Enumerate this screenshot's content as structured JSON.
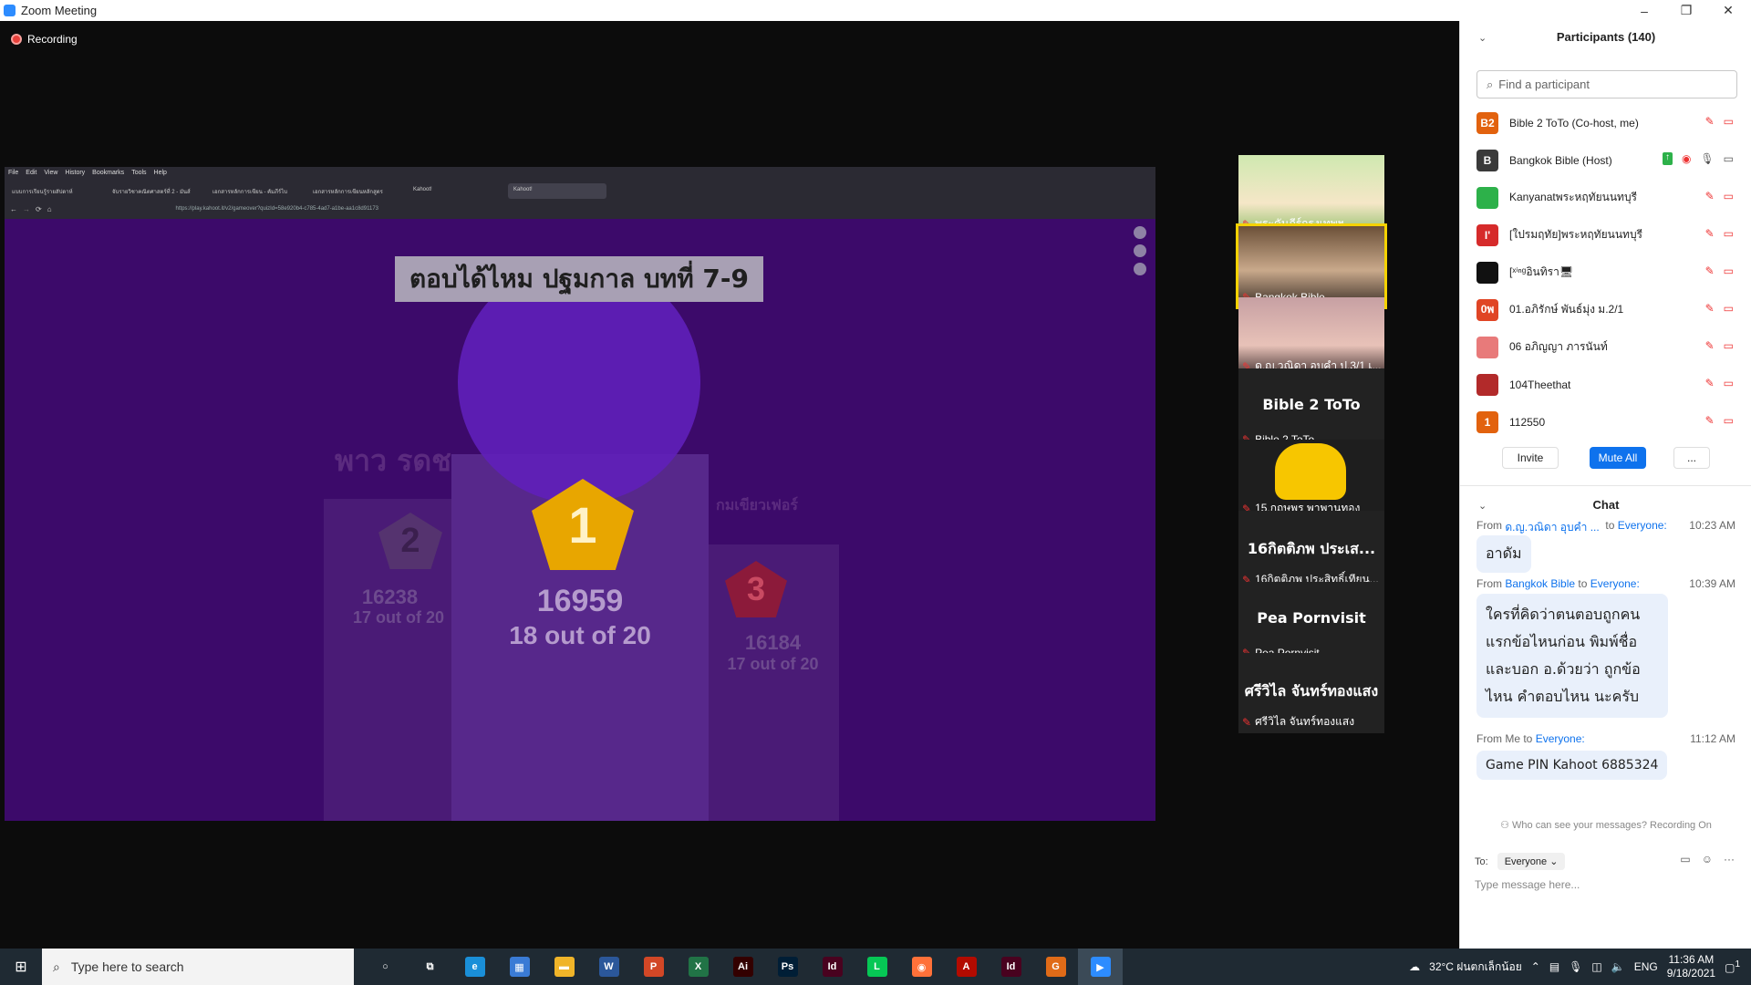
{
  "window": {
    "title": "Zoom Meeting",
    "minimize": "–",
    "restore": "❐",
    "close": "✕"
  },
  "recording_label": "Recording",
  "browser": {
    "menu": [
      "File",
      "Edit",
      "View",
      "History",
      "Bookmarks",
      "Tools",
      "Help"
    ],
    "tabs": [
      "แบบการเรียนรู้รายสัปดาห์",
      "จับรายวิชาคณิตศาสตร์ที่ 2 - มันส์",
      "เอกสารหลักการเขียน - คัมภีร์ไบ",
      "เอกสารหลักการเขียนหลักสูตร",
      "Kahoot!",
      "Kahoot!"
    ],
    "url": "https://play.kahoot.it/v2/gameover?quizId=58e920b4-c785-4ad7-a1be-aa1c8d91173"
  },
  "kahoot": {
    "question_title": "ตอบได้ไหม ปฐมกาล บทที่ 7-9",
    "nickname_2": "พาว รดช",
    "nickname_3": "กมเขียวเฟอร์",
    "place_1": {
      "rank": "1",
      "score": "16959",
      "correct": "18 out of 20"
    },
    "place_2": {
      "rank": "2",
      "score": "16238",
      "correct": "17 out of 20"
    },
    "place_3": {
      "rank": "3",
      "score": "16184",
      "correct": "17 out of 20"
    }
  },
  "gallery": [
    {
      "name": "พระคัมภีร์กรุงเทพฯ",
      "type": "poster"
    },
    {
      "name": "Bangkok Bible",
      "type": "video",
      "active": true
    },
    {
      "name": "ด.ญ.วณิดา อุบคำ ป.3/1 เ...",
      "type": "video"
    },
    {
      "name": "Bible 2 ToTo",
      "big": "Bible 2 ToTo",
      "type": "name"
    },
    {
      "name": "15.กฤษพร พาพานทอง",
      "type": "duck"
    },
    {
      "name": "16กิตติภพ ประสิทธิ์เทียน...",
      "big": "16กิตติภพ ประเส...",
      "type": "name"
    },
    {
      "name": "Pea Pornvisit",
      "big": "Pea Pornvisit",
      "type": "name"
    },
    {
      "name": "ศรีวิไล จันทร์ทองแสง",
      "big": "ศรีวิไล จันทร์ทองแสง",
      "type": "name"
    }
  ],
  "participants": {
    "header": "Participants (140)",
    "search_placeholder": "Find a participant",
    "list": [
      {
        "initials": "B2",
        "color": "#e2620e",
        "name": "Bible 2 ToTo (Co-host, me)"
      },
      {
        "initials": "B",
        "color": "#3a3a3a",
        "name": "Bangkok Bible (Host)"
      },
      {
        "initials": "",
        "color": "#2db14a",
        "name": "Kanyanatพระหฤทัยนนทบุรี"
      },
      {
        "initials": "I'",
        "color": "#d62b2b",
        "name": "[ใปรมฤทัย]พระหฤทัยนนทบุรี"
      },
      {
        "initials": "",
        "color": "#111111",
        "name": "[ˣⁱⁿᵍอินทิรา🖥"
      },
      {
        "initials": "0พ",
        "color": "#e04525",
        "name": "01.อภิรักษ์ พันธ์มุ่ง ม.2/1"
      },
      {
        "initials": "",
        "color": "#e87a7a",
        "name": "06 อภิญญา ภารนันท์"
      },
      {
        "initials": "",
        "color": "#b22a2a",
        "name": "104Theethat"
      },
      {
        "initials": "1",
        "color": "#e2620e",
        "name": "112550"
      }
    ],
    "invite": "Invite",
    "mute_all": "Mute All",
    "more": "..."
  },
  "chat": {
    "header": "Chat",
    "messages": [
      {
        "from": "From",
        "sender": "ด.ญ.วณิดา อุบคำ ...",
        "to_word": "to",
        "to": "Everyone:",
        "time": "10:23 AM",
        "text": "อาดัม"
      },
      {
        "from": "From",
        "sender": "Bangkok Bible",
        "to_word": "to",
        "to": "Everyone:",
        "time": "10:39 AM",
        "text": "ใครที่คิดว่าตนตอบถูกคนแรกข้อไหนก่อน พิมพ์ชื่อและบอก อ.ด้วยว่า ถูกข้อไหน คำตอบไหน นะครับ"
      },
      {
        "from": "From Me",
        "sender": "",
        "to_word": "to",
        "to": "Everyone:",
        "time": "11:12 AM",
        "text": "Game PIN Kahoot 6885324"
      }
    ],
    "who_can_see": "Who can see your messages? Recording On",
    "to_label": "To:",
    "to_value": "Everyone",
    "placeholder": "Type message here..."
  },
  "taskbar": {
    "search_placeholder": "Type here to search",
    "apps": [
      {
        "name": "cortana-icon",
        "glyph": "○",
        "color": "transparent"
      },
      {
        "name": "task-view-icon",
        "glyph": "⧉",
        "color": "transparent"
      },
      {
        "name": "edge-icon",
        "glyph": "e",
        "color": "#1a8fd8"
      },
      {
        "name": "calculator-icon",
        "glyph": "▦",
        "color": "#3a7bd5"
      },
      {
        "name": "file-explorer-icon",
        "glyph": "▬",
        "color": "#f0b429"
      },
      {
        "name": "word-icon",
        "glyph": "W",
        "color": "#2b579a"
      },
      {
        "name": "powerpoint-icon",
        "glyph": "P",
        "color": "#d24726"
      },
      {
        "name": "excel-icon",
        "glyph": "X",
        "color": "#217346"
      },
      {
        "name": "illustrator-icon",
        "glyph": "Ai",
        "color": "#330000"
      },
      {
        "name": "photoshop-icon",
        "glyph": "Ps",
        "color": "#001e36"
      },
      {
        "name": "indesign-icon",
        "glyph": "Id",
        "color": "#49021f"
      },
      {
        "name": "line-icon",
        "glyph": "L",
        "color": "#06c755"
      },
      {
        "name": "firefox-icon",
        "glyph": "◉",
        "color": "#ff7139"
      },
      {
        "name": "acrobat-icon",
        "glyph": "A",
        "color": "#b30b00"
      },
      {
        "name": "indesign2-icon",
        "glyph": "Id",
        "color": "#49021f"
      },
      {
        "name": "grammarly-icon",
        "glyph": "G",
        "color": "#e06b18"
      },
      {
        "name": "zoom-icon",
        "glyph": "▶",
        "color": "#2d8cff"
      }
    ],
    "weather": "32°C  ฝนตกเล็กน้อย",
    "lang": "ENG",
    "time": "11:36 AM",
    "date": "9/18/2021",
    "notification_count": "1"
  }
}
